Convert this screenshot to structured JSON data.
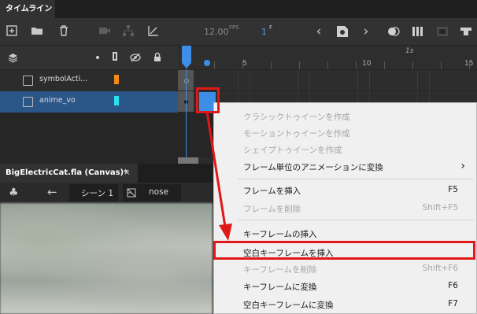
{
  "timeline": {
    "title": "タイムライン",
    "fps_value": "12.00",
    "fps_unit": "FPS",
    "frame_value": "1",
    "frame_unit": "F"
  },
  "ruler": {
    "labels": [
      "5",
      "10",
      "15"
    ],
    "seconds_label": "1s"
  },
  "layers": [
    {
      "name": "symbolActi...",
      "color": "#f28a16"
    },
    {
      "name": "anime_vo",
      "color": "#28e0f0"
    }
  ],
  "document": {
    "tab_title": "BigElectricCat.fla (Canvas)*",
    "tab_close": "×",
    "scene": "シーン 1",
    "symbol": "nose"
  },
  "context_menu": {
    "items": [
      {
        "label": "クラシックトゥイーンを作成",
        "shortcut": "",
        "enabled": false
      },
      {
        "label": "モーショントゥイーンを作成",
        "shortcut": "",
        "enabled": false
      },
      {
        "label": "シェイプトゥイーンを作成",
        "shortcut": "",
        "enabled": false
      },
      {
        "label": "フレーム単位のアニメーションに変換",
        "shortcut": "",
        "enabled": true,
        "submenu": true
      },
      {
        "label": "フレームを挿入",
        "shortcut": "F5",
        "enabled": true
      },
      {
        "label": "フレームを削除",
        "shortcut": "Shift+F5",
        "enabled": false
      },
      {
        "label": "キーフレームの挿入",
        "shortcut": "",
        "enabled": true
      },
      {
        "label": "空白キーフレームを挿入",
        "shortcut": "",
        "enabled": true,
        "highlighted": true
      },
      {
        "label": "キーフレームを削除",
        "shortcut": "Shift+F6",
        "enabled": false
      },
      {
        "label": "キーフレームに変換",
        "shortcut": "F6",
        "enabled": true
      },
      {
        "label": "空白キーフレームに変換",
        "shortcut": "F7",
        "enabled": true
      }
    ],
    "submenu_arrow": "›"
  },
  "colors": {
    "accent": "#3d8ee6",
    "highlight_red": "#e01818",
    "selected_layer": "#2a5688"
  }
}
